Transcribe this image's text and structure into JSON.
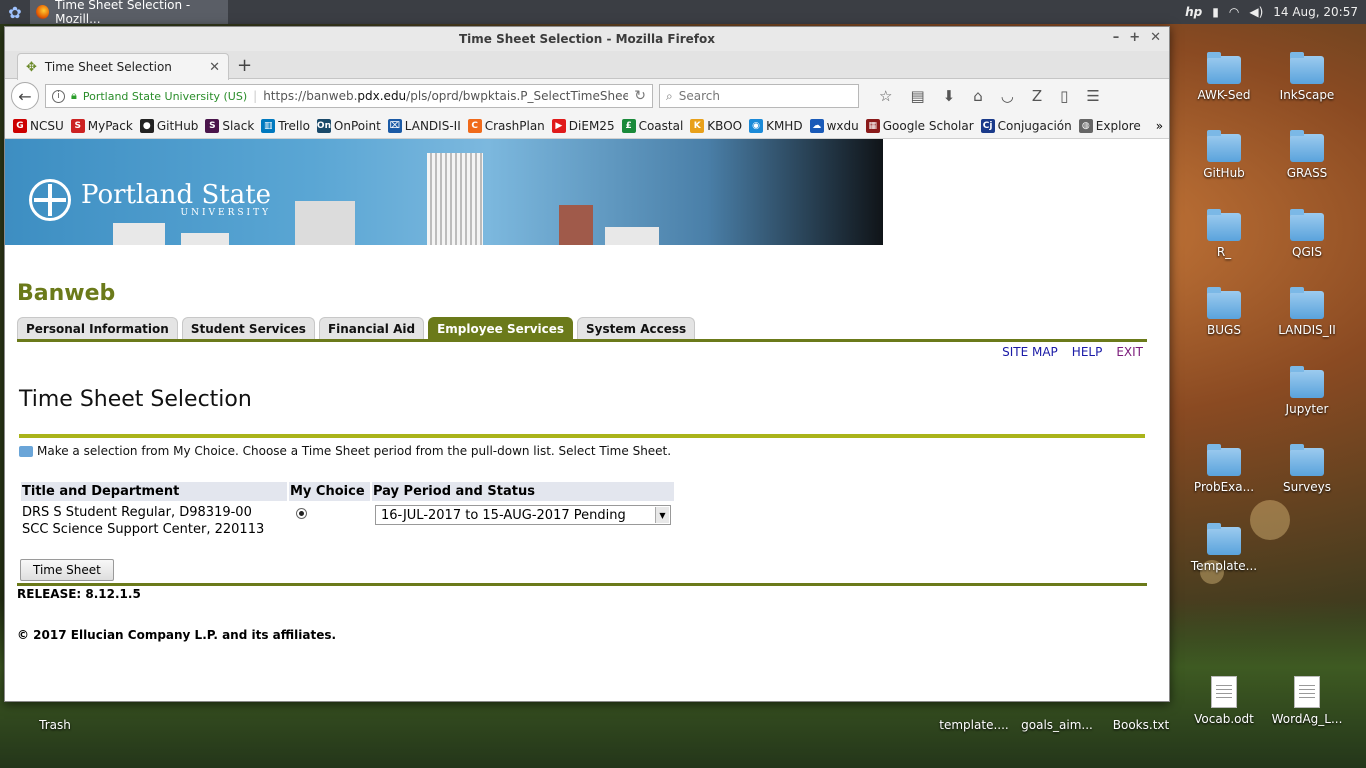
{
  "taskbar": {
    "task_label": "Time Sheet Selection - Mozill...",
    "clock": "14 Aug, 20:57"
  },
  "desktop": {
    "icons": [
      "AWK-Sed",
      "InkScape",
      "GitHub",
      "GRASS",
      "R_",
      "QGIS",
      "BUGS",
      "LANDIS_II",
      "Jupyter",
      "ProbExa...",
      "Surveys",
      "Template..."
    ],
    "bottom_icons": [
      "Trash",
      "template....",
      "goals_aim...",
      "Books.txt",
      "Vocab.odt",
      "WordAg_L..."
    ]
  },
  "browser": {
    "window_title": "Time Sheet Selection - Mozilla Firefox",
    "tab_title": "Time Sheet Selection",
    "identity": "Portland State University (US)",
    "url_prefix": "https://banweb.",
    "url_domain": "pdx.edu",
    "url_path": "/pls/oprd/bwpktais.P_SelectTimeSheetI",
    "search_placeholder": "Search",
    "bookmarks": [
      {
        "label": "NCSU",
        "color": "#cc0000",
        "icon": "G"
      },
      {
        "label": "MyPack",
        "color": "#cc2222",
        "icon": "S"
      },
      {
        "label": "GitHub",
        "color": "#222222",
        "icon": "●"
      },
      {
        "label": "Slack",
        "color": "#4a154b",
        "icon": "S"
      },
      {
        "label": "Trello",
        "color": "#0079bf",
        "icon": "▥"
      },
      {
        "label": "OnPoint",
        "color": "#1a4a6a",
        "icon": "On"
      },
      {
        "label": "LANDIS-II",
        "color": "#1a5aa6",
        "icon": "⌧"
      },
      {
        "label": "CrashPlan",
        "color": "#f06a1a",
        "icon": "C"
      },
      {
        "label": "DiEM25",
        "color": "#e01a1a",
        "icon": "▶"
      },
      {
        "label": "Coastal",
        "color": "#1a8a3a",
        "icon": "£"
      },
      {
        "label": "KBOO",
        "color": "#e8a01a",
        "icon": "K"
      },
      {
        "label": "KMHD",
        "color": "#1a8ad8",
        "icon": "◉"
      },
      {
        "label": "wxdu",
        "color": "#1a5ab8",
        "icon": "☁"
      },
      {
        "label": "Google Scholar",
        "color": "#8a1a1a",
        "icon": "▦"
      },
      {
        "label": "Conjugación",
        "color": "#1a3a8a",
        "icon": "Cj"
      },
      {
        "label": "Explore",
        "color": "#666666",
        "icon": "◍"
      }
    ]
  },
  "page": {
    "banweb_title": "Banweb",
    "nav_tabs": [
      "Personal Information",
      "Student Services",
      "Financial Aid",
      "Employee Services",
      "System Access"
    ],
    "active_tab": "Employee Services",
    "links": {
      "site_map": "SITE MAP",
      "help": "HELP",
      "exit": "EXIT"
    },
    "title": "Time Sheet Selection",
    "instructions": "Make a selection from My Choice. Choose a Time Sheet period from the pull-down list. Select Time Sheet.",
    "table": {
      "headers": [
        "Title and Department",
        "My Choice",
        "Pay Period and Status"
      ],
      "row": {
        "title_line1": "DRS S Student Regular, D98319-00",
        "title_line2": "SCC Science Support Center, 220113",
        "pay_period": "16-JUL-2017 to 15-AUG-2017 Pending"
      }
    },
    "button_label": "Time Sheet",
    "release": "RELEASE: 8.12.1.5",
    "copyright": "© 2017 Ellucian Company L.P. and its affiliates."
  },
  "colors": {
    "banweb_green": "#6b7a1a",
    "title_rule": "#aab41a",
    "link_blue": "#1a1aa6"
  }
}
